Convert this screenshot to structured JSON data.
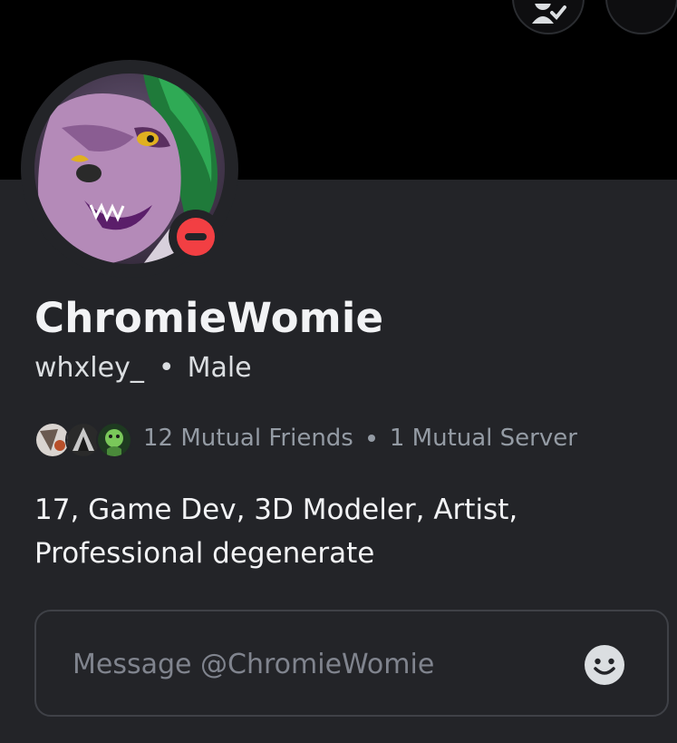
{
  "header": {
    "top_buttons": [
      {
        "icon": "add-friend-icon"
      },
      {
        "icon": "more-icon"
      }
    ]
  },
  "profile": {
    "display_name": "ChromieWomie",
    "username": "whxley_",
    "separator": "•",
    "pronouns": "Male",
    "status": "do-not-disturb",
    "status_color": "#f23f43",
    "mutual_friends": "12 Mutual Friends",
    "mutual_servers": "1 Mutual Server",
    "bio_line_1": "17, Game Dev, 3D Modeler, Artist,",
    "bio_line_2": "Professional degenerate"
  },
  "message": {
    "placeholder": "Message @ChromieWomie",
    "value": "",
    "emoji_icon": "smiley-face-icon"
  },
  "colors": {
    "background": "#232428",
    "banner": "#000000",
    "text_primary": "#f2f3f5",
    "text_muted": "#949ba4"
  }
}
